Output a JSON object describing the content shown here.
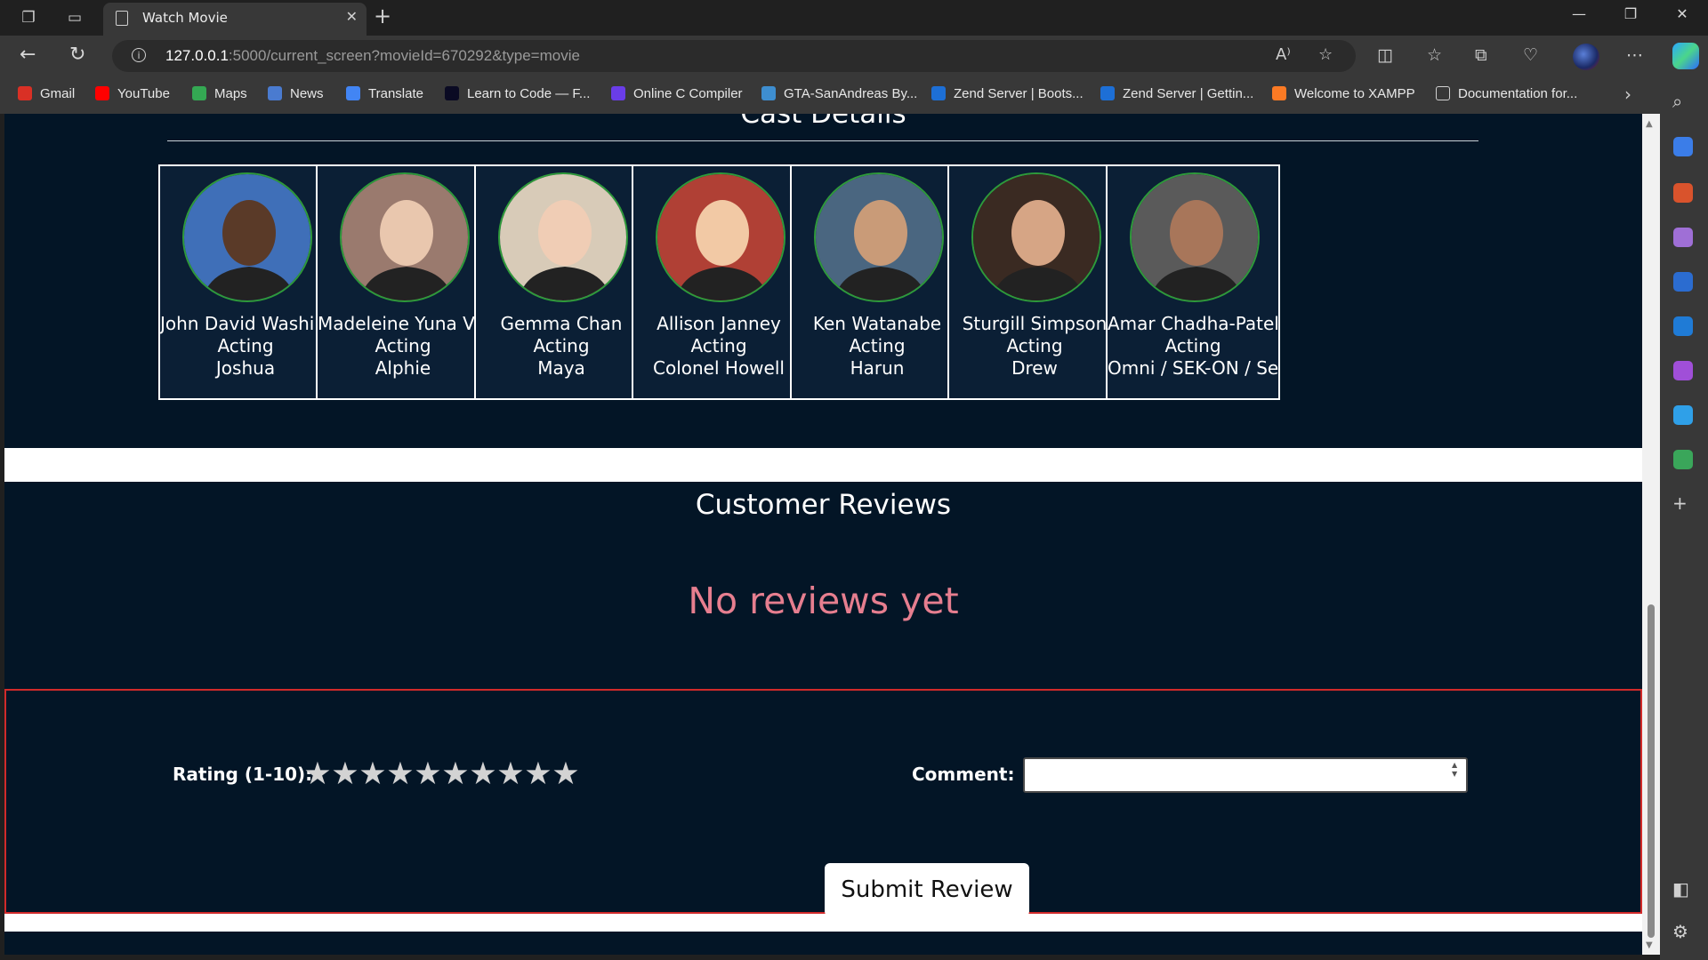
{
  "browser": {
    "tab_title": "Watch Movie",
    "url_host": "127.0.0.1",
    "url_rest": ":5000/current_screen?movieId=670292&type=movie",
    "bookmarks": [
      {
        "label": "Gmail",
        "color": "#d93025"
      },
      {
        "label": "YouTube",
        "color": "#ff0000"
      },
      {
        "label": "Maps",
        "color": "#34a853"
      },
      {
        "label": "News",
        "color": "#4a7bd0"
      },
      {
        "label": "Translate",
        "color": "#4285f4"
      },
      {
        "label": "Learn to Code — F...",
        "color": "#0a0a23"
      },
      {
        "label": "Online C Compiler",
        "color": "#6a3de8"
      },
      {
        "label": "GTA-SanAndreas By...",
        "color": "#3e8ed0"
      },
      {
        "label": "Zend Server | Boots...",
        "color": "#1d6fd6"
      },
      {
        "label": "Zend Server | Gettin...",
        "color": "#1d6fd6"
      },
      {
        "label": "Welcome to XAMPP",
        "color": "#fb7a24"
      },
      {
        "label": "Documentation for...",
        "color": "#383838"
      }
    ]
  },
  "cast": {
    "heading": "Cast Details",
    "members": [
      {
        "name": "John David Washington",
        "role": "Acting",
        "character": "Joshua",
        "skin": "#5a3a28",
        "bg": "#3f6fb8"
      },
      {
        "name": "Madeleine Yuna Voyles",
        "role": "Acting",
        "character": "Alphie",
        "skin": "#e9c7ae",
        "bg": "#9a7a6e"
      },
      {
        "name": "Gemma Chan",
        "role": "Acting",
        "character": "Maya",
        "skin": "#f0cdb5",
        "bg": "#d8cbb8"
      },
      {
        "name": "Allison Janney",
        "role": "Acting",
        "character": "Colonel Howell",
        "skin": "#f2c9a5",
        "bg": "#b04035"
      },
      {
        "name": "Ken Watanabe",
        "role": "Acting",
        "character": "Harun",
        "skin": "#c99b78",
        "bg": "#4a6680"
      },
      {
        "name": "Sturgill Simpson",
        "role": "Acting",
        "character": "Drew",
        "skin": "#d6a585",
        "bg": "#3a2a22"
      },
      {
        "name": "Amar Chadha-Patel",
        "role": "Acting",
        "character": "Omni / SEK-ON / Sentry",
        "skin": "#a8765a",
        "bg": "#5a5a5a"
      }
    ]
  },
  "reviews": {
    "heading": "Customer Reviews",
    "empty_message": "No reviews yet"
  },
  "form": {
    "rating_label": "Rating (1-10):",
    "rating_max": 10,
    "rating_value": 0,
    "star_glyph": "★",
    "comment_label": "Comment:",
    "comment_value": "",
    "submit_label": "Submit Review"
  },
  "colors": {
    "page_bg": "#031526",
    "empty_message": "#e67e8f",
    "form_border": "#d12a2a"
  }
}
